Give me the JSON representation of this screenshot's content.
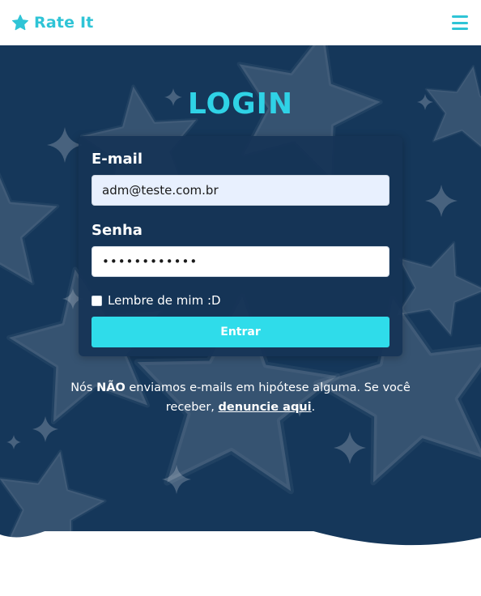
{
  "navbar": {
    "brand": "Rate It",
    "brand_icon": "star-icon",
    "menu_icon": "hamburger-menu-icon",
    "accent": "#2fc4d6"
  },
  "hero": {
    "background": "#15375a",
    "title": "LOGIN",
    "title_color": "#2fd2e6"
  },
  "form": {
    "email_label": "E-mail",
    "email_value": "adm@teste.com.br",
    "password_label": "Senha",
    "password_value": "••••••••••••",
    "remember_label": "Lembre de mim :D",
    "remember_checked": false,
    "submit_label": "Entrar",
    "submit_color": "#2fdcea"
  },
  "notice": {
    "part1": "Nós ",
    "emphasis": "NÃO",
    "part2": " enviamos e-mails em hipótese alguma. Se você receber, ",
    "link": "denuncie aqui",
    "part3": "."
  }
}
